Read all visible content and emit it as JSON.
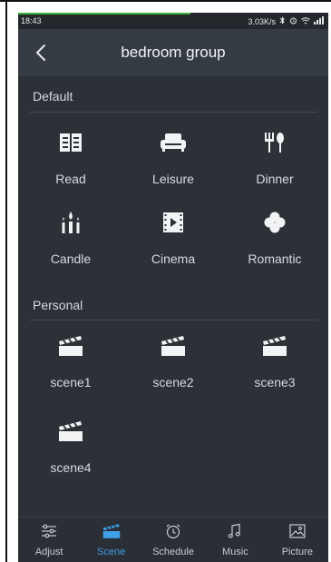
{
  "statusbar": {
    "time": "18:43",
    "speed": "3.03K/s"
  },
  "header": {
    "title": "bedroom group"
  },
  "default": {
    "title": "Default",
    "items": [
      {
        "label": "Read",
        "icon": "book-icon"
      },
      {
        "label": "Leisure",
        "icon": "sofa-icon"
      },
      {
        "label": "Dinner",
        "icon": "fork-knife-icon"
      },
      {
        "label": "Candle",
        "icon": "candle-icon"
      },
      {
        "label": "Cinema",
        "icon": "film-icon"
      },
      {
        "label": "Romantic",
        "icon": "clover-icon"
      }
    ]
  },
  "personal": {
    "title": "Personal",
    "items": [
      {
        "label": "scene1",
        "icon": "clapperboard-icon"
      },
      {
        "label": "scene2",
        "icon": "clapperboard-icon"
      },
      {
        "label": "scene3",
        "icon": "clapperboard-icon"
      },
      {
        "label": "scene4",
        "icon": "clapperboard-icon"
      }
    ]
  },
  "nav": {
    "items": [
      {
        "label": "Adjust",
        "icon": "sliders-icon"
      },
      {
        "label": "Scene",
        "icon": "clapperboard-icon"
      },
      {
        "label": "Schedule",
        "icon": "alarm-clock-icon"
      },
      {
        "label": "Music",
        "icon": "music-note-icon"
      },
      {
        "label": "Picture",
        "icon": "picture-icon"
      }
    ],
    "active": "Scene"
  },
  "colors": {
    "background": "#2c3137",
    "header": "#353b43",
    "icon": "#f2f3f5",
    "active": "#3f9fe6",
    "progress": "#3fae3a"
  }
}
